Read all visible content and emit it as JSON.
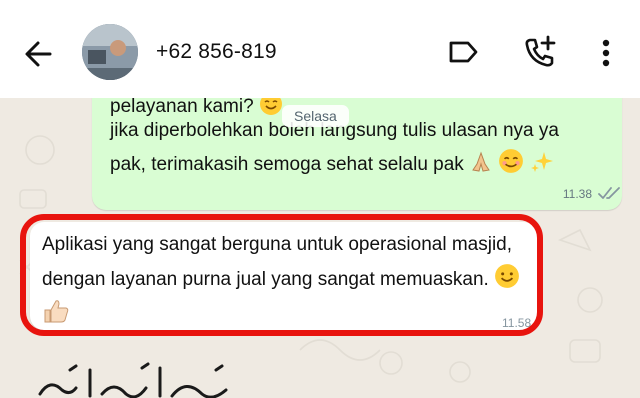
{
  "header": {
    "contact_name": "+62 856-819",
    "back_icon": "arrow-left-icon",
    "label_icon": "label-icon",
    "call_icon": "add-call-icon",
    "more_icon": "more-vert-icon"
  },
  "date_chip": "Selasa",
  "messages": [
    {
      "direction": "outgoing",
      "lines": [
        "pelayanan kami?",
        "jika diperbolehkan boleh langsung tulis ulasan nya ya",
        "pak, terimakasih semoga sehat selalu pak"
      ],
      "time": "11.38",
      "status_icon": "double-check-icon"
    },
    {
      "direction": "incoming",
      "lines": [
        "Aplikasi yang sangat berguna untuk operasional masjid,",
        "dengan layanan purna jual yang sangat memuaskan."
      ],
      "time": "11.58",
      "reaction_icon": "thumbs-up-icon"
    }
  ],
  "colors": {
    "outgoing_bubble": "#d9fdd3",
    "incoming_bubble": "#ffffff",
    "chat_background": "#efeae2",
    "highlight": "#e8140e",
    "read_ticks": "#8696a0"
  }
}
